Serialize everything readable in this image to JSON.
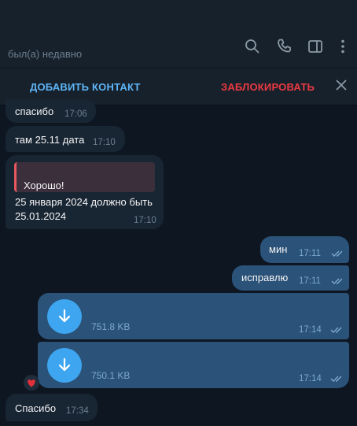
{
  "header": {
    "status": "был(а) недавно"
  },
  "actions": {
    "add_contact": "ДОБАВИТЬ КОНТАКТ",
    "block": "ЗАБЛОКИРОВАТЬ"
  },
  "messages": [
    {
      "text": "спасибо",
      "time": "17:06"
    },
    {
      "text": "там 25.11 дата",
      "time": "17:10"
    },
    {
      "reply_text": "Хорошо!",
      "text_line1": "25 января 2024 должно быть",
      "text_line2": "25.01.2024",
      "time": "17:10"
    },
    {
      "text": "мин",
      "time": "17:11"
    },
    {
      "text": "исправлю",
      "time": "17:11"
    },
    {
      "file_size": "751.8 KB",
      "time": "17:14"
    },
    {
      "file_size": "750.1 KB",
      "time": "17:14"
    },
    {
      "text": "Спасибо",
      "time": "17:34"
    }
  ],
  "colors": {
    "background": "#0e1621",
    "incoming_bubble": "#182533",
    "outgoing_bubble": "#2b5278",
    "accent": "#5eb5f7",
    "danger": "#ec3942",
    "download_button": "#3ea6f0",
    "reaction": "#e0303a"
  },
  "icons": [
    "search-icon",
    "phone-icon",
    "sidebar-toggle-icon",
    "more-vertical-icon",
    "close-icon",
    "download-icon",
    "checkmarks-icon",
    "heart-icon"
  ]
}
